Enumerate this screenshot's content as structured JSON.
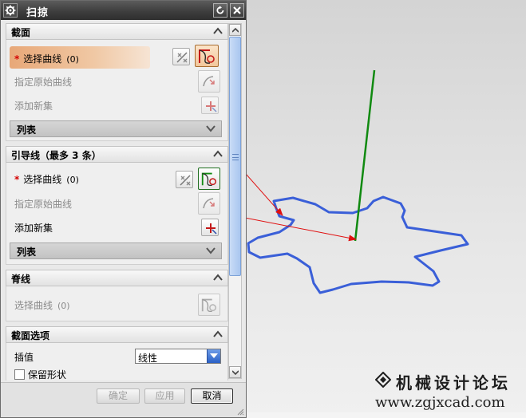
{
  "title": "扫掠",
  "sections": {
    "section": {
      "title": "截面",
      "select_curve": "选择曲线",
      "count": "(0)",
      "origin_curve": "指定原始曲线",
      "add_set": "添加新集",
      "list": "列表"
    },
    "guide": {
      "title": "引导线（最多 3 条）",
      "select_curve": "选择曲线",
      "count": "(0)",
      "origin_curve": "指定原始曲线",
      "add_set": "添加新集",
      "list": "列表"
    },
    "spine": {
      "title": "脊线",
      "select_curve": "选择曲线",
      "count": "(0)"
    },
    "options": {
      "title": "截面选项",
      "interp_label": "插值",
      "interp_value": "线性",
      "keep_shape": "保留形状"
    }
  },
  "footer": {
    "ok": "确定",
    "apply": "应用",
    "cancel": "取消"
  },
  "watermark": {
    "cn": "机械设计论坛",
    "url": "www.zgjxcad.com"
  },
  "colors": {
    "curve": "#3a5fd8",
    "guide_line": "#108a10",
    "arrow": "#e01010",
    "title_bar": "#3e3e3e",
    "highlight_row": "#e8a878"
  }
}
